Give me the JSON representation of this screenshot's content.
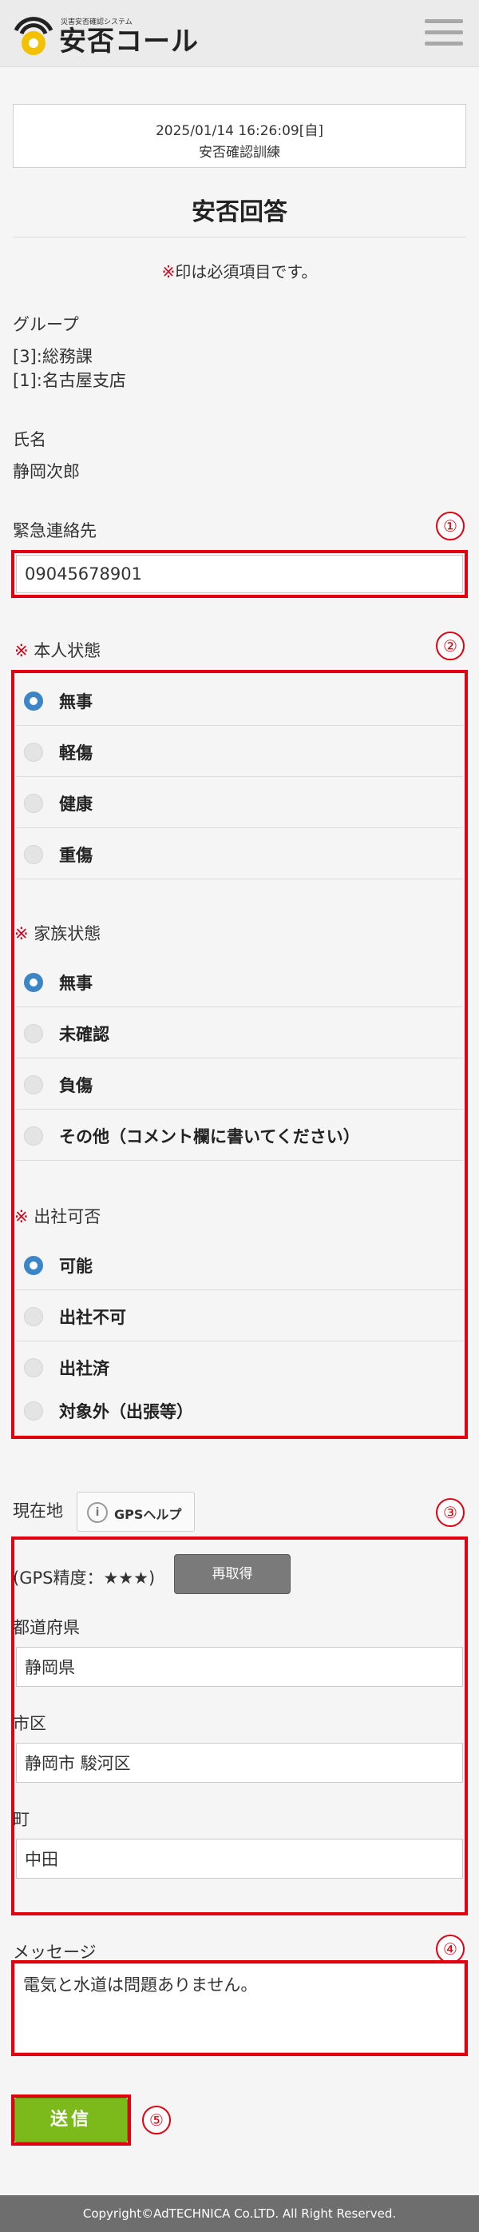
{
  "header": {
    "logo_sub": "災害安否確認システム",
    "logo_text": "安否コール",
    "menu_icon": "hamburger-icon"
  },
  "info": {
    "datetime": "2025/01/14 16:26:09[自]",
    "event": "安否確認訓練"
  },
  "page_title": "安否回答",
  "required_note": {
    "mark": "※",
    "text": "印は必須項目です。"
  },
  "group": {
    "label": "グループ",
    "values": [
      "[3]:総務課",
      "[1]:名古屋支店"
    ]
  },
  "name": {
    "label": "氏名",
    "value": "静岡次郎"
  },
  "emergency_contact": {
    "label": "緊急連絡先",
    "value": "09045678901",
    "marker": "①"
  },
  "status_marker": "②",
  "self_status": {
    "mark": "※",
    "label": "本人状態",
    "options": [
      {
        "label": "無事",
        "selected": true
      },
      {
        "label": "軽傷",
        "selected": false
      },
      {
        "label": "健康",
        "selected": false
      },
      {
        "label": "重傷",
        "selected": false
      }
    ]
  },
  "family_status": {
    "mark": "※",
    "label": "家族状態",
    "options": [
      {
        "label": "無事",
        "selected": true
      },
      {
        "label": "未確認",
        "selected": false
      },
      {
        "label": "負傷",
        "selected": false
      },
      {
        "label": "その他（コメント欄に書いてください）",
        "selected": false
      }
    ]
  },
  "attendance": {
    "mark": "※",
    "label": "出社可否",
    "options": [
      {
        "label": "可能",
        "selected": true
      },
      {
        "label": "出社不可",
        "selected": false
      },
      {
        "label": "出社済",
        "selected": false
      },
      {
        "label": "対象外（出張等）",
        "selected": false
      }
    ]
  },
  "location": {
    "label": "現在地",
    "gps_help": "GPSヘルプ",
    "marker": "③",
    "gps_accuracy": "(GPS精度：★★★)",
    "reacquire": "再取得",
    "prefecture_label": "都道府県",
    "prefecture": "静岡県",
    "city_label": "市区",
    "city": "静岡市 駿河区",
    "town_label": "町",
    "town": "中田"
  },
  "message": {
    "label": "メッセージ",
    "value": "電気と水道は問題ありません。",
    "marker": "④"
  },
  "send": {
    "label": "送信",
    "marker": "⑤"
  },
  "footer": "Copyright©AdTECHNICA Co.LTD. All Right Reserved.",
  "colors": {
    "accent_red": "#e3000f",
    "radio_selected": "#3b86c6",
    "send_green": "#7cba1c"
  }
}
